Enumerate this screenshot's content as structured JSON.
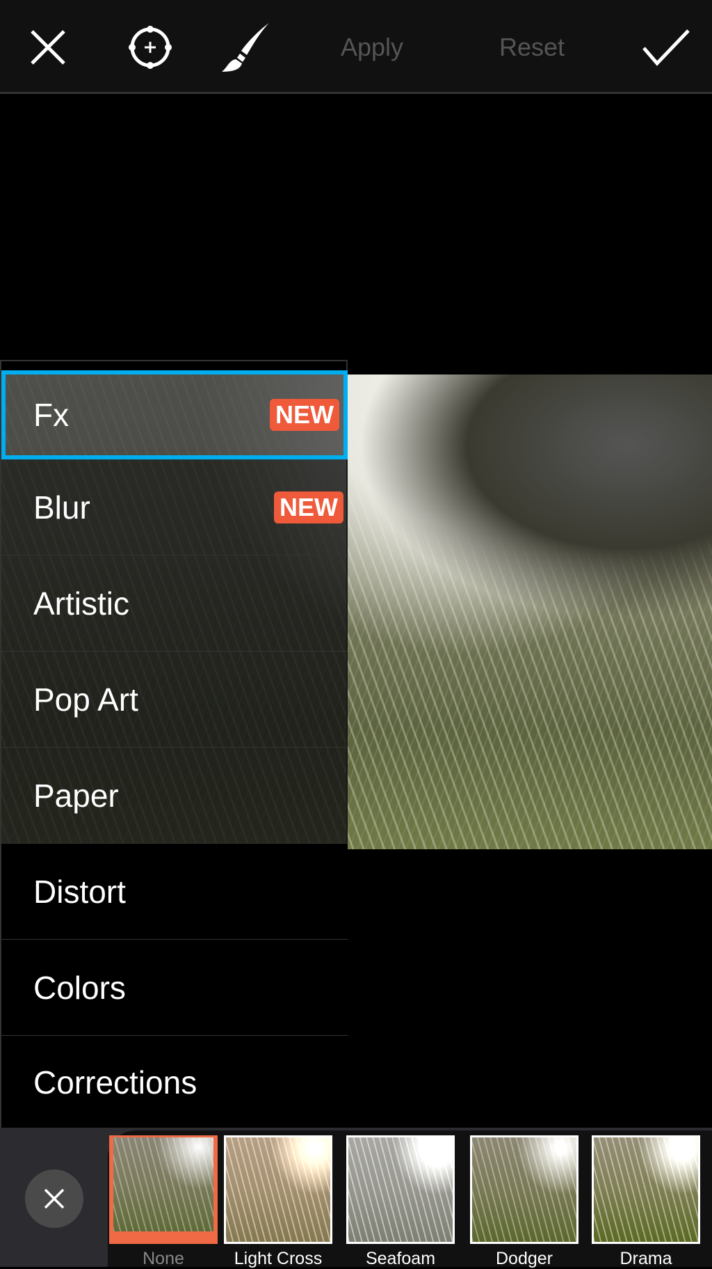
{
  "toolbar": {
    "close_icon": "close-icon",
    "target_icon": "target-icon",
    "brush_icon": "brush-icon",
    "apply": "Apply",
    "reset": "Reset",
    "confirm_icon": "checkmark-icon"
  },
  "menu": {
    "items": [
      {
        "label": "Fx",
        "badge": "NEW",
        "selected": true
      },
      {
        "label": "Blur",
        "badge": "NEW"
      },
      {
        "label": "Artistic"
      },
      {
        "label": "Pop Art"
      },
      {
        "label": "Paper"
      },
      {
        "label": "Distort"
      },
      {
        "label": "Colors"
      },
      {
        "label": "Corrections"
      }
    ]
  },
  "effects": {
    "close_icon": "close-icon",
    "items": [
      {
        "label": "None",
        "selected": true
      },
      {
        "label": "Light Cross"
      },
      {
        "label": "Seafoam"
      },
      {
        "label": "Dodger"
      },
      {
        "label": "Drama"
      }
    ]
  },
  "colors": {
    "accent": "#00aef0",
    "badge": "#ef5a3a",
    "selected_effect": "#ef6a45"
  }
}
